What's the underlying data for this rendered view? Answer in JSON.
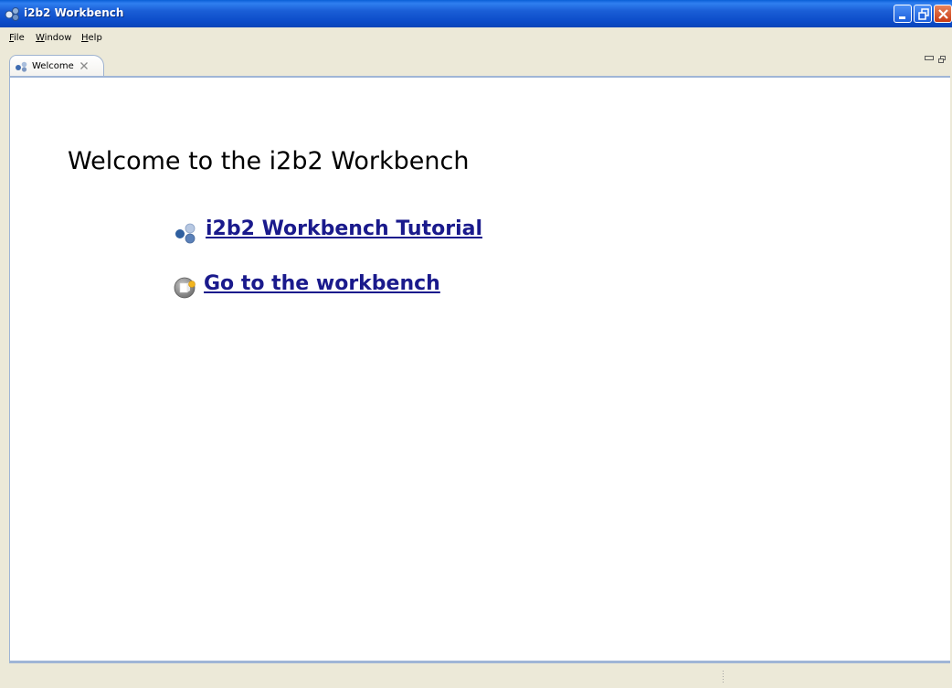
{
  "window": {
    "title": "i2b2 Workbench",
    "title_icon": "i2b2-logo-icon",
    "controls": [
      "minimize-icon",
      "restore-icon",
      "close-icon"
    ]
  },
  "menubar": {
    "items": [
      {
        "label": "File"
      },
      {
        "label": "Window"
      },
      {
        "label": "Help"
      }
    ]
  },
  "tabs": [
    {
      "label": "Welcome",
      "icon": "i2b2-logo-icon",
      "active": true,
      "closable": true
    }
  ],
  "welcome": {
    "heading": "Welcome to the i2b2 Workbench",
    "links": [
      {
        "label": "i2b2 Workbench Tutorial",
        "icon": "i2b2-logo-icon"
      },
      {
        "label": "Go to the workbench",
        "icon": "workbench-icon"
      }
    ]
  },
  "colors": {
    "titlebar": "#0b4bc8",
    "chrome": "#ece9d8",
    "content_bg": "#ffffff",
    "link": "#1a1a8c",
    "panel_border": "#9fb5d6"
  }
}
